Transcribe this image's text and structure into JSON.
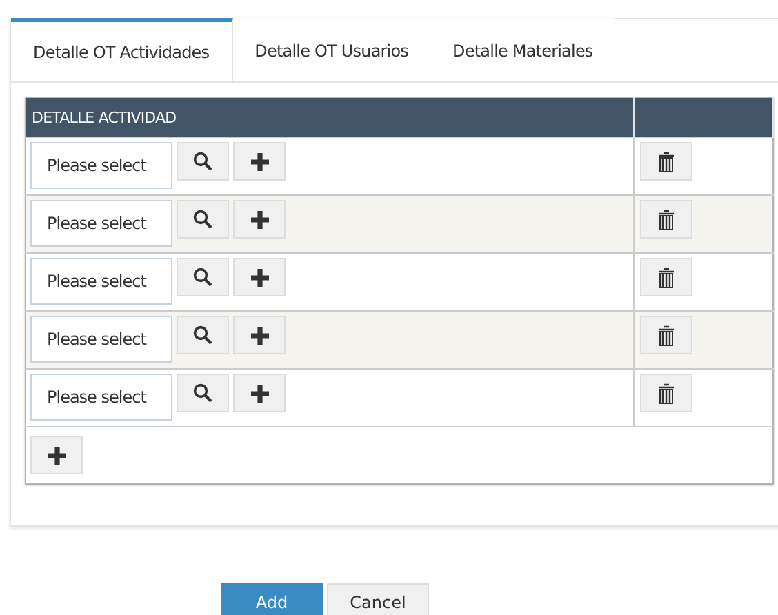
{
  "tabs": [
    {
      "label": "Detalle OT Actividades",
      "selected": true
    },
    {
      "label": "Detalle OT Usuarios",
      "selected": false
    },
    {
      "label": "Detalle Materiales",
      "selected": false
    }
  ],
  "table": {
    "columns": [
      "DETALLE ACTIVIDAD"
    ],
    "rows": [
      {
        "placeholder": "Please select"
      },
      {
        "placeholder": "Please select"
      },
      {
        "placeholder": "Please select"
      },
      {
        "placeholder": "Please select"
      },
      {
        "placeholder": "Please select"
      }
    ]
  },
  "buttons": [
    {
      "label": "Add",
      "kind": "primary"
    },
    {
      "label": "Cancel",
      "kind": "secondary"
    }
  ]
}
